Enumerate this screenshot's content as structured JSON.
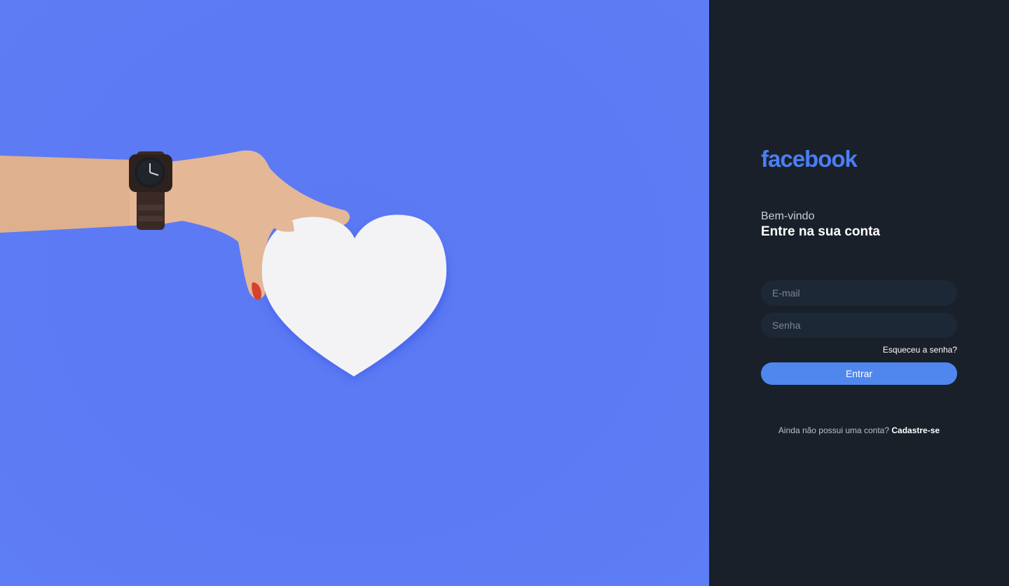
{
  "brand": {
    "logo_text": "facebook",
    "color": "#4b7ef2"
  },
  "login": {
    "welcome": "Bem-vindo",
    "headline": "Entre na sua conta",
    "email_placeholder": "E-mail",
    "password_placeholder": "Senha",
    "forgot_label": "Esqueceu a senha?",
    "submit_label": "Entrar",
    "signup_prompt": "Ainda não possui uma conta?",
    "signup_link": "Cadastre-se"
  },
  "colors": {
    "hero_background": "#5c7af4",
    "panel_background": "#19202a",
    "input_background": "#1d2837",
    "button": "#5087ee"
  },
  "hero": {
    "icons": [
      "hand-icon",
      "wristwatch-icon",
      "heart-icon"
    ]
  }
}
